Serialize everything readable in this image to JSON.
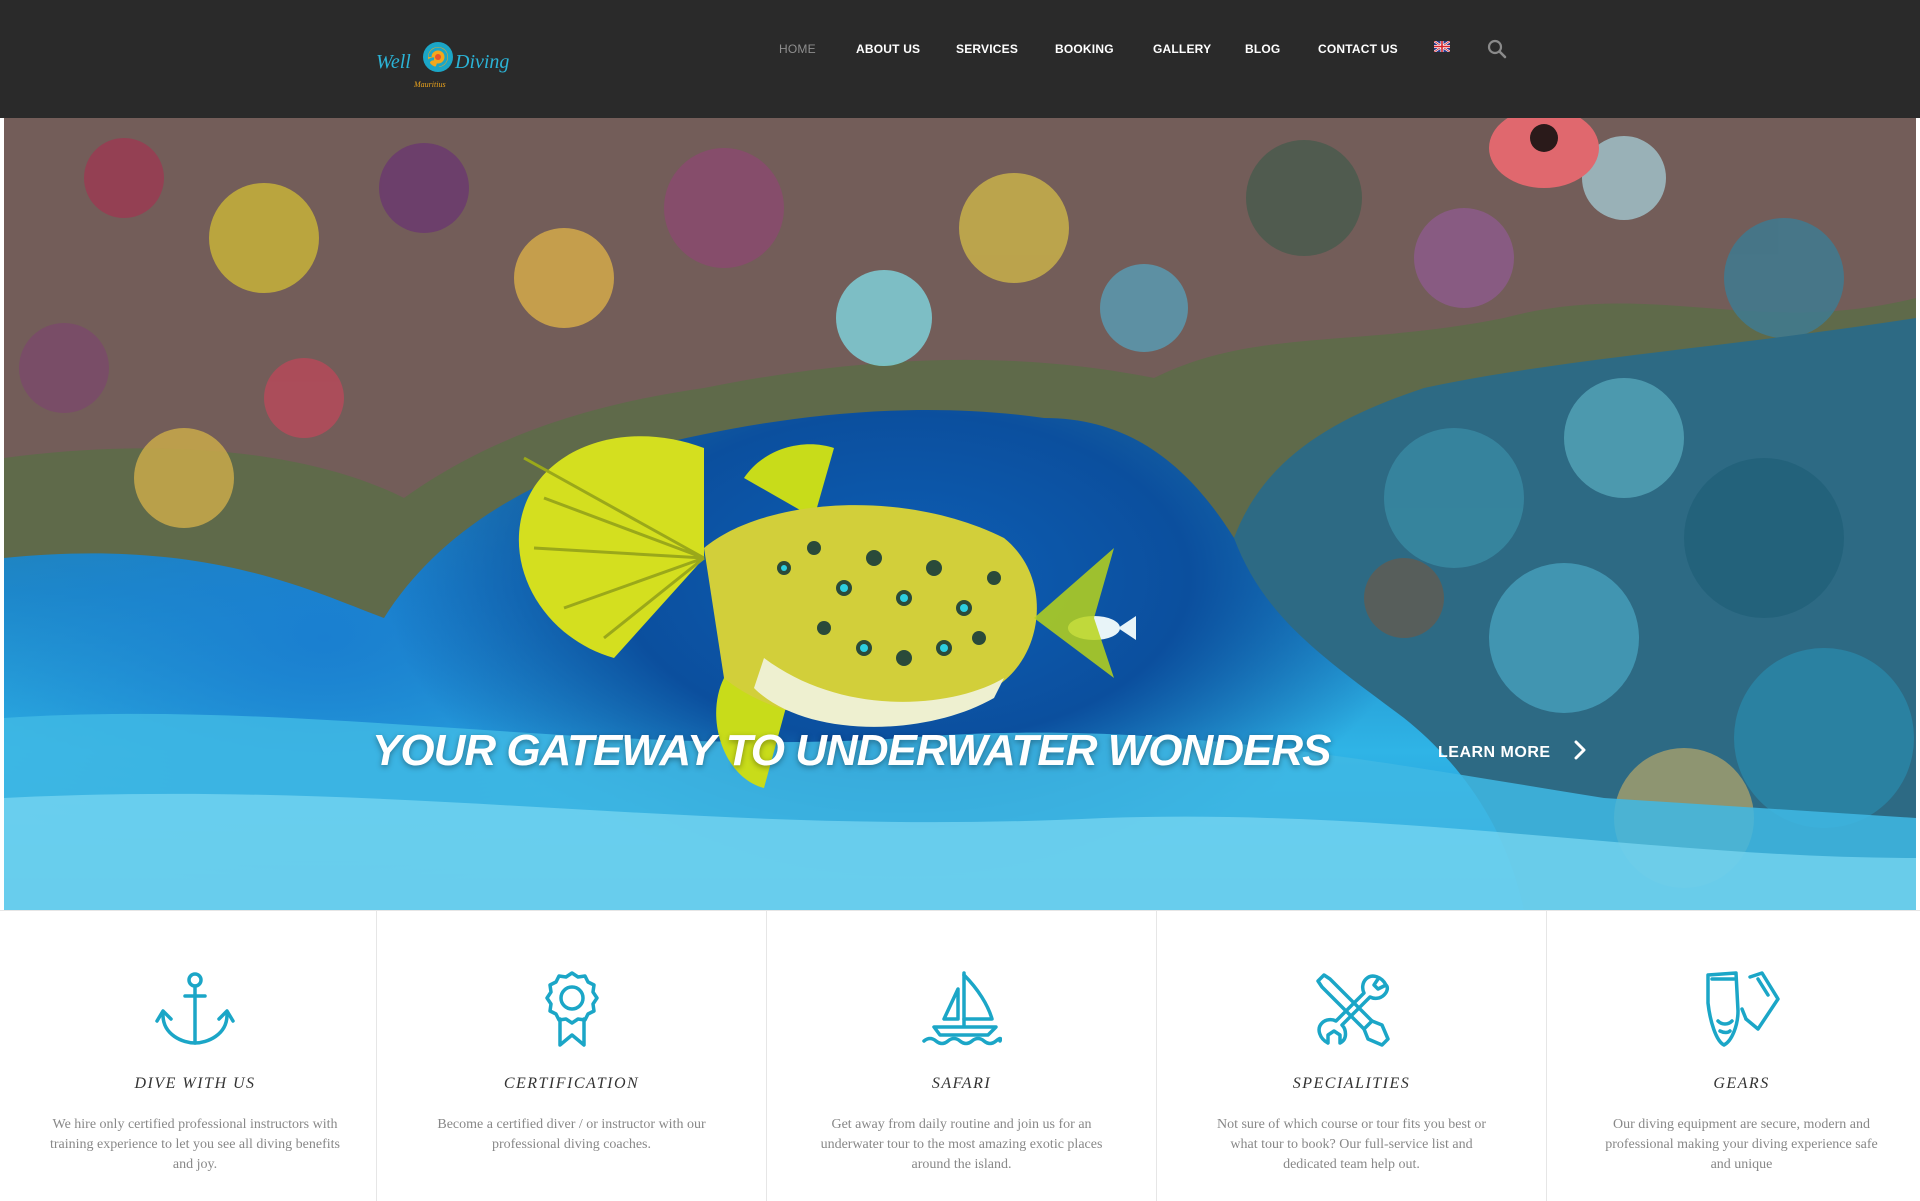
{
  "header": {
    "logo_text_left": "Well",
    "logo_text_right": "Diving",
    "logo_sub": "Mauritius",
    "nav": [
      {
        "label": "HOME",
        "active": true
      },
      {
        "label": "ABOUT US",
        "active": false
      },
      {
        "label": "SERVICES",
        "active": false
      },
      {
        "label": "BOOKING",
        "active": false
      },
      {
        "label": "GALLERY",
        "active": false
      },
      {
        "label": "BLOG",
        "active": false
      },
      {
        "label": "CONTACT US",
        "active": false
      }
    ],
    "language_icon": "uk-flag-icon",
    "search_icon": "search-icon"
  },
  "hero": {
    "title": "YOUR GATEWAY TO UNDERWATER WONDERS",
    "cta_label": "LEARN MORE"
  },
  "features": [
    {
      "icon": "anchor-icon",
      "title": "DIVE WITH US",
      "desc": "We hire only certified professional instructors with training experience to let you see all diving benefits and joy."
    },
    {
      "icon": "award-ribbon-icon",
      "title": "CERTIFICATION",
      "desc": "Become a certified diver / or instructor with our professional diving coaches."
    },
    {
      "icon": "sailboat-icon",
      "title": "SAFARI",
      "desc": "Get away from daily routine and join us for an underwater tour to the most amazing exotic places around the island."
    },
    {
      "icon": "tools-icon",
      "title": "SPECIALITIES",
      "desc": "Not sure of which course or tour fits you best or what tour to book? Our full-service list and dedicated team help out."
    },
    {
      "icon": "fins-icon",
      "title": "GEARS",
      "desc": "Our diving equipment are secure, modern and professional making your diving experience safe and unique"
    }
  ],
  "colors": {
    "header_bg": "#2a2a2a",
    "accent": "#1ba6c7",
    "nav_active": "#8e8e8e",
    "text_muted": "#888888"
  }
}
